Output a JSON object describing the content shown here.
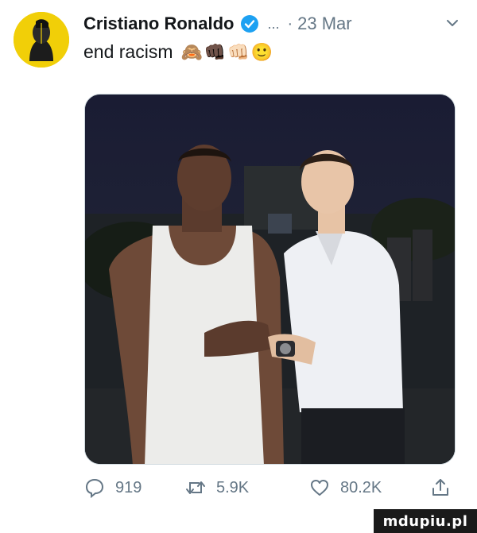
{
  "tweet": {
    "author_name": "Cristiano Ronaldo",
    "ellipsis": "...",
    "separator": "·",
    "date": "23 Mar",
    "text": "end racism",
    "emojis": [
      "🙈",
      "👊🏿",
      "👊🏻",
      "🙂"
    ]
  },
  "actions": {
    "reply_count": "919",
    "retweet_count": "5.9K",
    "like_count": "80.2K"
  },
  "icons": {
    "verified": "verified-badge-icon",
    "chevron": "chevron-down-icon",
    "reply": "reply-icon",
    "retweet": "retweet-icon",
    "like": "heart-icon",
    "share": "share-icon"
  },
  "colors": {
    "verified": "#1da1f2",
    "muted": "#657786",
    "avatar_bg": "#f1cf08"
  },
  "watermark": "mdupiu.pl"
}
